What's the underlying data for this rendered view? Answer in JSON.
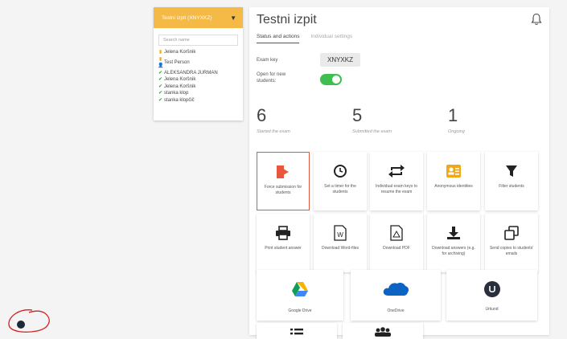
{
  "exam_selector": {
    "label": "Testni izpit (XNYXKZ)"
  },
  "search": {
    "placeholder": "Search name"
  },
  "students": [
    {
      "name": "Jelena Koršnik",
      "status": "yellow"
    },
    {
      "name": "Test Person",
      "status": "yellow-person"
    },
    {
      "name": "ALEKSANDRA JURMAN",
      "status": "green"
    },
    {
      "name": "Jelena Koršnik",
      "status": "green"
    },
    {
      "name": "Jelena Koršnik",
      "status": "green"
    },
    {
      "name": "stanka klop",
      "status": "green"
    },
    {
      "name": "stanka klopčič",
      "status": "green"
    }
  ],
  "header": {
    "title": "Testni izpit"
  },
  "tabs": [
    {
      "label": "Status and actions",
      "active": true
    },
    {
      "label": "Individual settings",
      "active": false
    }
  ],
  "exam_key": {
    "label": "Exam key",
    "value": "XNYXKZ"
  },
  "open_for_new": {
    "label": "Open for new students:",
    "on": true
  },
  "stats": [
    {
      "value": "6",
      "label": "Started the exam"
    },
    {
      "value": "5",
      "label": "Submitted the exam"
    },
    {
      "value": "1",
      "label": "Ongoing"
    }
  ],
  "actions": [
    {
      "label": "Force submission for students",
      "icon": "force-submit-icon"
    },
    {
      "label": "Set a timer for the students",
      "icon": "clock-icon"
    },
    {
      "label": "Individual exam keys to resume the exam",
      "icon": "repeat-icon"
    },
    {
      "label": "Anonymous identities",
      "icon": "id-card-icon"
    },
    {
      "label": "Filter students",
      "icon": "filter-icon"
    },
    {
      "label": "Print student answer",
      "icon": "printer-icon"
    },
    {
      "label": "Download Word-files",
      "icon": "word-file-icon"
    },
    {
      "label": "Download PDF",
      "icon": "pdf-file-icon"
    },
    {
      "label": "Download answers (e.g. for archiving)",
      "icon": "download-icon"
    },
    {
      "label": "Send copies to students' emails",
      "icon": "copy-icon"
    },
    {
      "label": "Google Drive",
      "icon": "google-drive-icon"
    },
    {
      "label": "OneDrive",
      "icon": "onedrive-icon"
    },
    {
      "label": "Urkund",
      "icon": "urkund-icon"
    }
  ],
  "colors": {
    "accent": "#f5b945",
    "toggle_on": "#3fbf4f",
    "highlight": "#e05a40"
  }
}
